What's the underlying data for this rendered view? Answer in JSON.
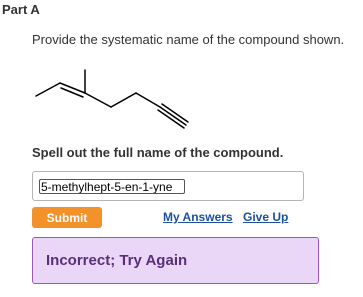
{
  "part": {
    "title": "Part A"
  },
  "question": {
    "prompt": "Provide the systematic name of the compound shown.",
    "instruction": "Spell out the full name of the compound."
  },
  "answer": {
    "value": "5-methylhept-5-en-1-yne"
  },
  "actions": {
    "submit_label": "Submit",
    "my_answers_label": "My Answers",
    "give_up_label": "Give Up"
  },
  "feedback": {
    "message": "Incorrect; Try Again"
  },
  "colors": {
    "submit": "#f3922a",
    "link": "#1c4f9c",
    "feedback_bg": "#ead7f7",
    "feedback_border": "#9b59b6",
    "feedback_text": "#5a2e7a"
  },
  "molecule": {
    "name": "skeletal-structure",
    "bonds": [
      "single",
      "double",
      "single",
      "single",
      "single",
      "triple"
    ]
  }
}
